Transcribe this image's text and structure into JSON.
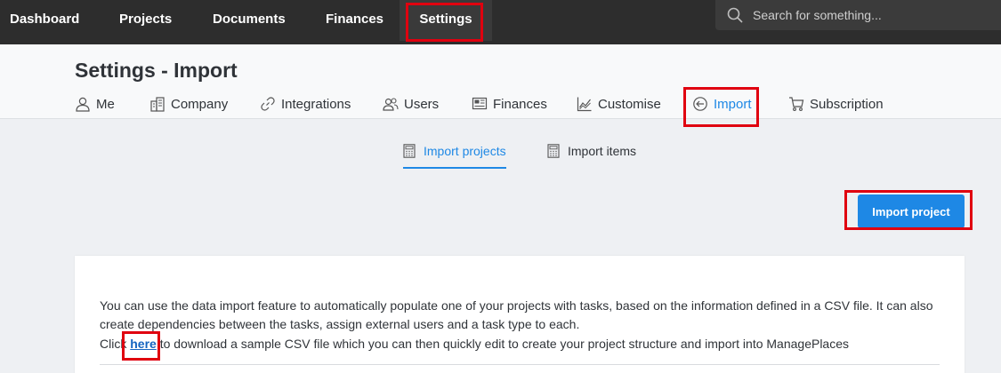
{
  "topnav": {
    "items": [
      {
        "label": "Dashboard"
      },
      {
        "label": "Projects"
      },
      {
        "label": "Documents"
      },
      {
        "label": "Finances"
      },
      {
        "label": "Settings",
        "active": true
      }
    ],
    "search": {
      "placeholder": "Search for something..."
    }
  },
  "header": {
    "title": "Settings - Import",
    "tabs": [
      {
        "label": "Me",
        "icon": "user-icon"
      },
      {
        "label": "Company",
        "icon": "building-icon"
      },
      {
        "label": "Integrations",
        "icon": "link-icon"
      },
      {
        "label": "Users",
        "icon": "users-icon"
      },
      {
        "label": "Finances",
        "icon": "finances-icon"
      },
      {
        "label": "Customise",
        "icon": "chart-icon"
      },
      {
        "label": "Import",
        "icon": "import-icon",
        "active": true
      },
      {
        "label": "Subscription",
        "icon": "cart-icon"
      }
    ]
  },
  "subtabs": [
    {
      "label": "Import projects",
      "icon": "calculator-icon",
      "active": true
    },
    {
      "label": "Import items",
      "icon": "calculator-icon"
    }
  ],
  "actions": {
    "import_project": "Import project"
  },
  "content": {
    "paragraph": "You can use the data import feature to automatically populate one of your projects with tasks, based on the information defined in a CSV file. It can also create dependencies between the tasks, assign external users and a task type to each.",
    "download_prefix": "Click ",
    "download_link": "here",
    "download_suffix": " to download a sample CSV file which you can then quickly edit to create your project structure and import into ManagePlaces"
  },
  "colors": {
    "accent": "#1e88e5",
    "nav_bg": "#2d2d2d",
    "highlight": "#e0000f"
  }
}
